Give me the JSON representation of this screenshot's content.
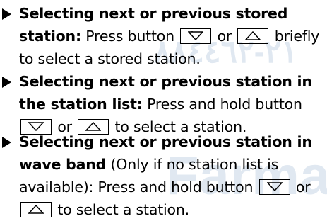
{
  "watermark": {
    "top": "٢١-٨٨٤٤٦٢",
    "bottom": "Farmas"
  },
  "items": [
    {
      "title": "Selecting next or previous stored station:",
      "part1": " Press button ",
      "button1": "down-arrow",
      "or": " or ",
      "button2": "up-arrow",
      "part2": " briefly to select a stored station."
    },
    {
      "title": "Selecting next or previous station in the station list:",
      "part1": " Press and hold button ",
      "button1": "down-arrow",
      "or": " or ",
      "button2": "up-arrow",
      "part2": " to select a station."
    },
    {
      "title": "Selecting next or previous station in wave band",
      "note": " (Only if no station list is available): Press and hold button ",
      "button1": "down-arrow",
      "or": " or ",
      "button2": "up-arrow",
      "part2": " to select a station."
    }
  ]
}
